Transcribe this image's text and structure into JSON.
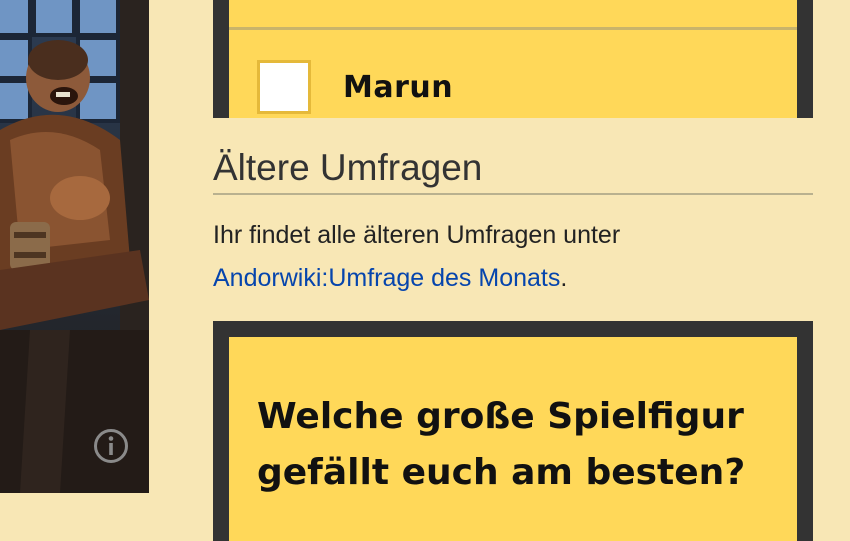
{
  "sidebar_image": {
    "alt_icon": "info-icon"
  },
  "poll_top": {
    "option_label": "Marun"
  },
  "section": {
    "heading": "Ältere Umfragen",
    "text_before": "Ihr findet alle älteren Umfragen unter",
    "link_text": "Andorwiki:Umfrage des Monats",
    "text_after": "."
  },
  "poll_bottom": {
    "question": "Welche große Spielfigur gefällt euch am besten?"
  },
  "colors": {
    "page_bg": "#f8e7b5",
    "poll_bg": "#ffd859",
    "poll_border": "#333333",
    "link": "#0645ad"
  }
}
